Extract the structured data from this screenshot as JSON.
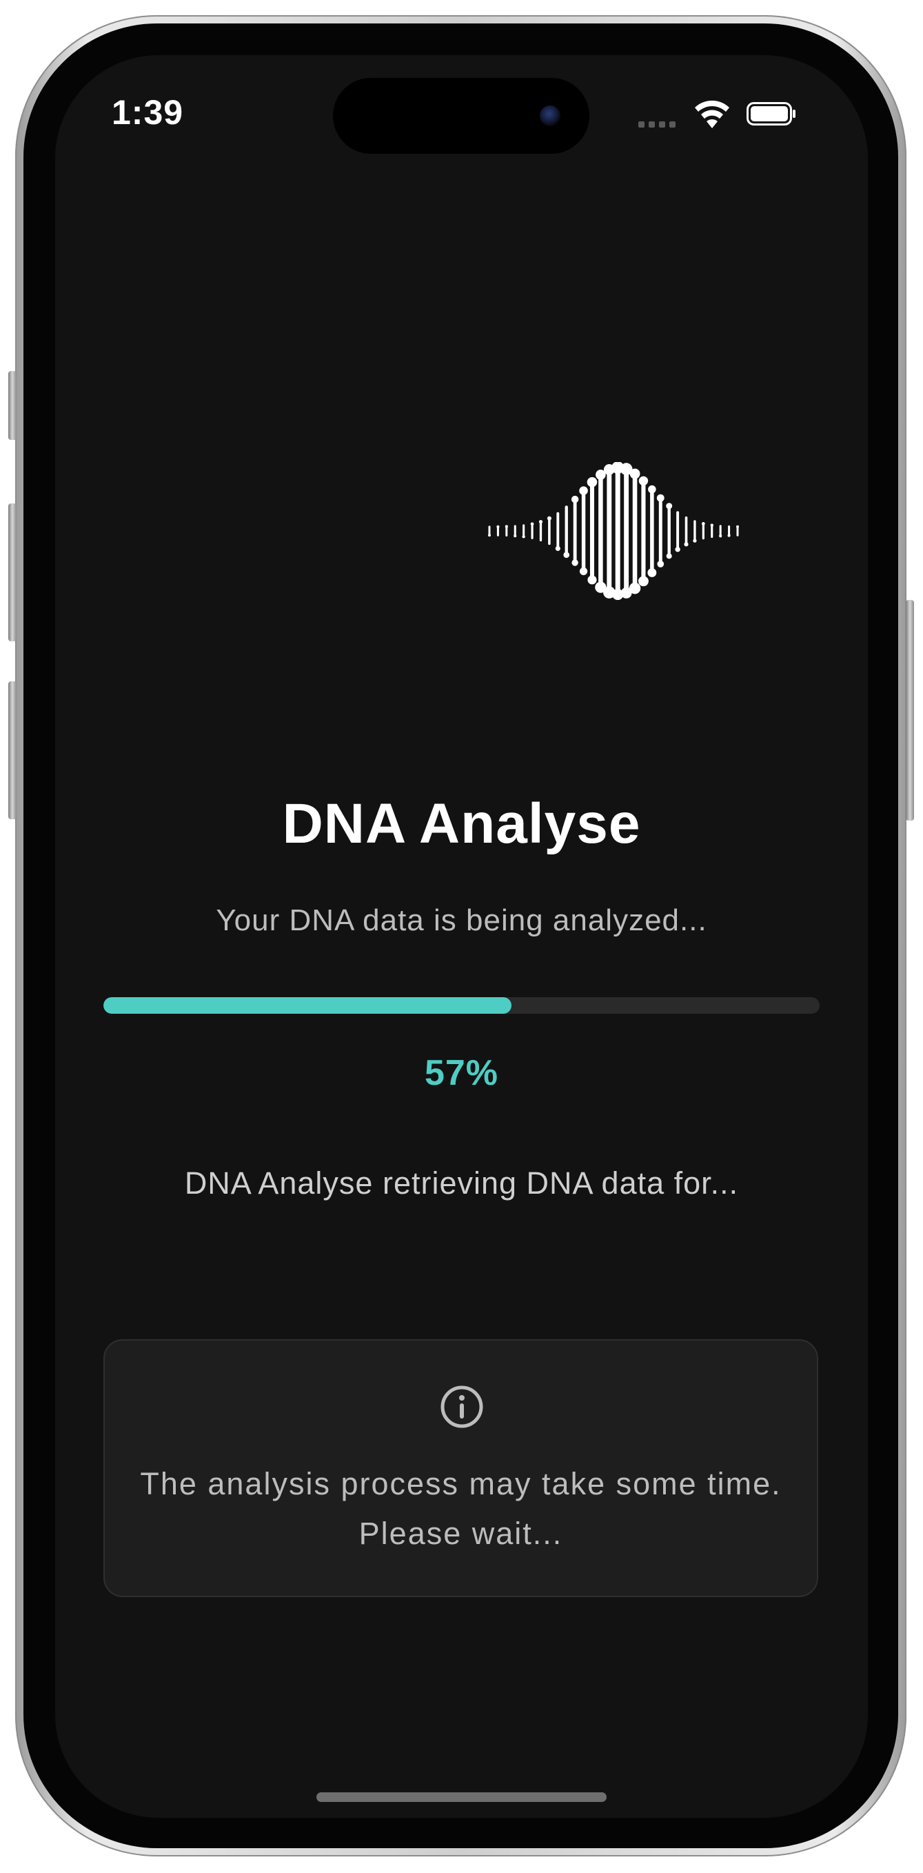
{
  "status_bar": {
    "time": "1:39"
  },
  "app": {
    "title": "DNA Analyse",
    "subtitle": "Your DNA data is being analyzed...",
    "progress": {
      "value": 0.57,
      "label": "57%"
    },
    "status_message": "DNA Analyse retrieving DNA data for...",
    "info_card": {
      "icon": "info-icon",
      "text": "The analysis process may take some time. Please wait..."
    }
  },
  "colors": {
    "accent": "#4ecdc4",
    "background": "#121212",
    "card": "#1e1e1e",
    "track": "#2a2a2a"
  },
  "icons": [
    "dna-helix-icon",
    "wifi-icon",
    "battery-icon",
    "signal-icon",
    "info-icon"
  ]
}
